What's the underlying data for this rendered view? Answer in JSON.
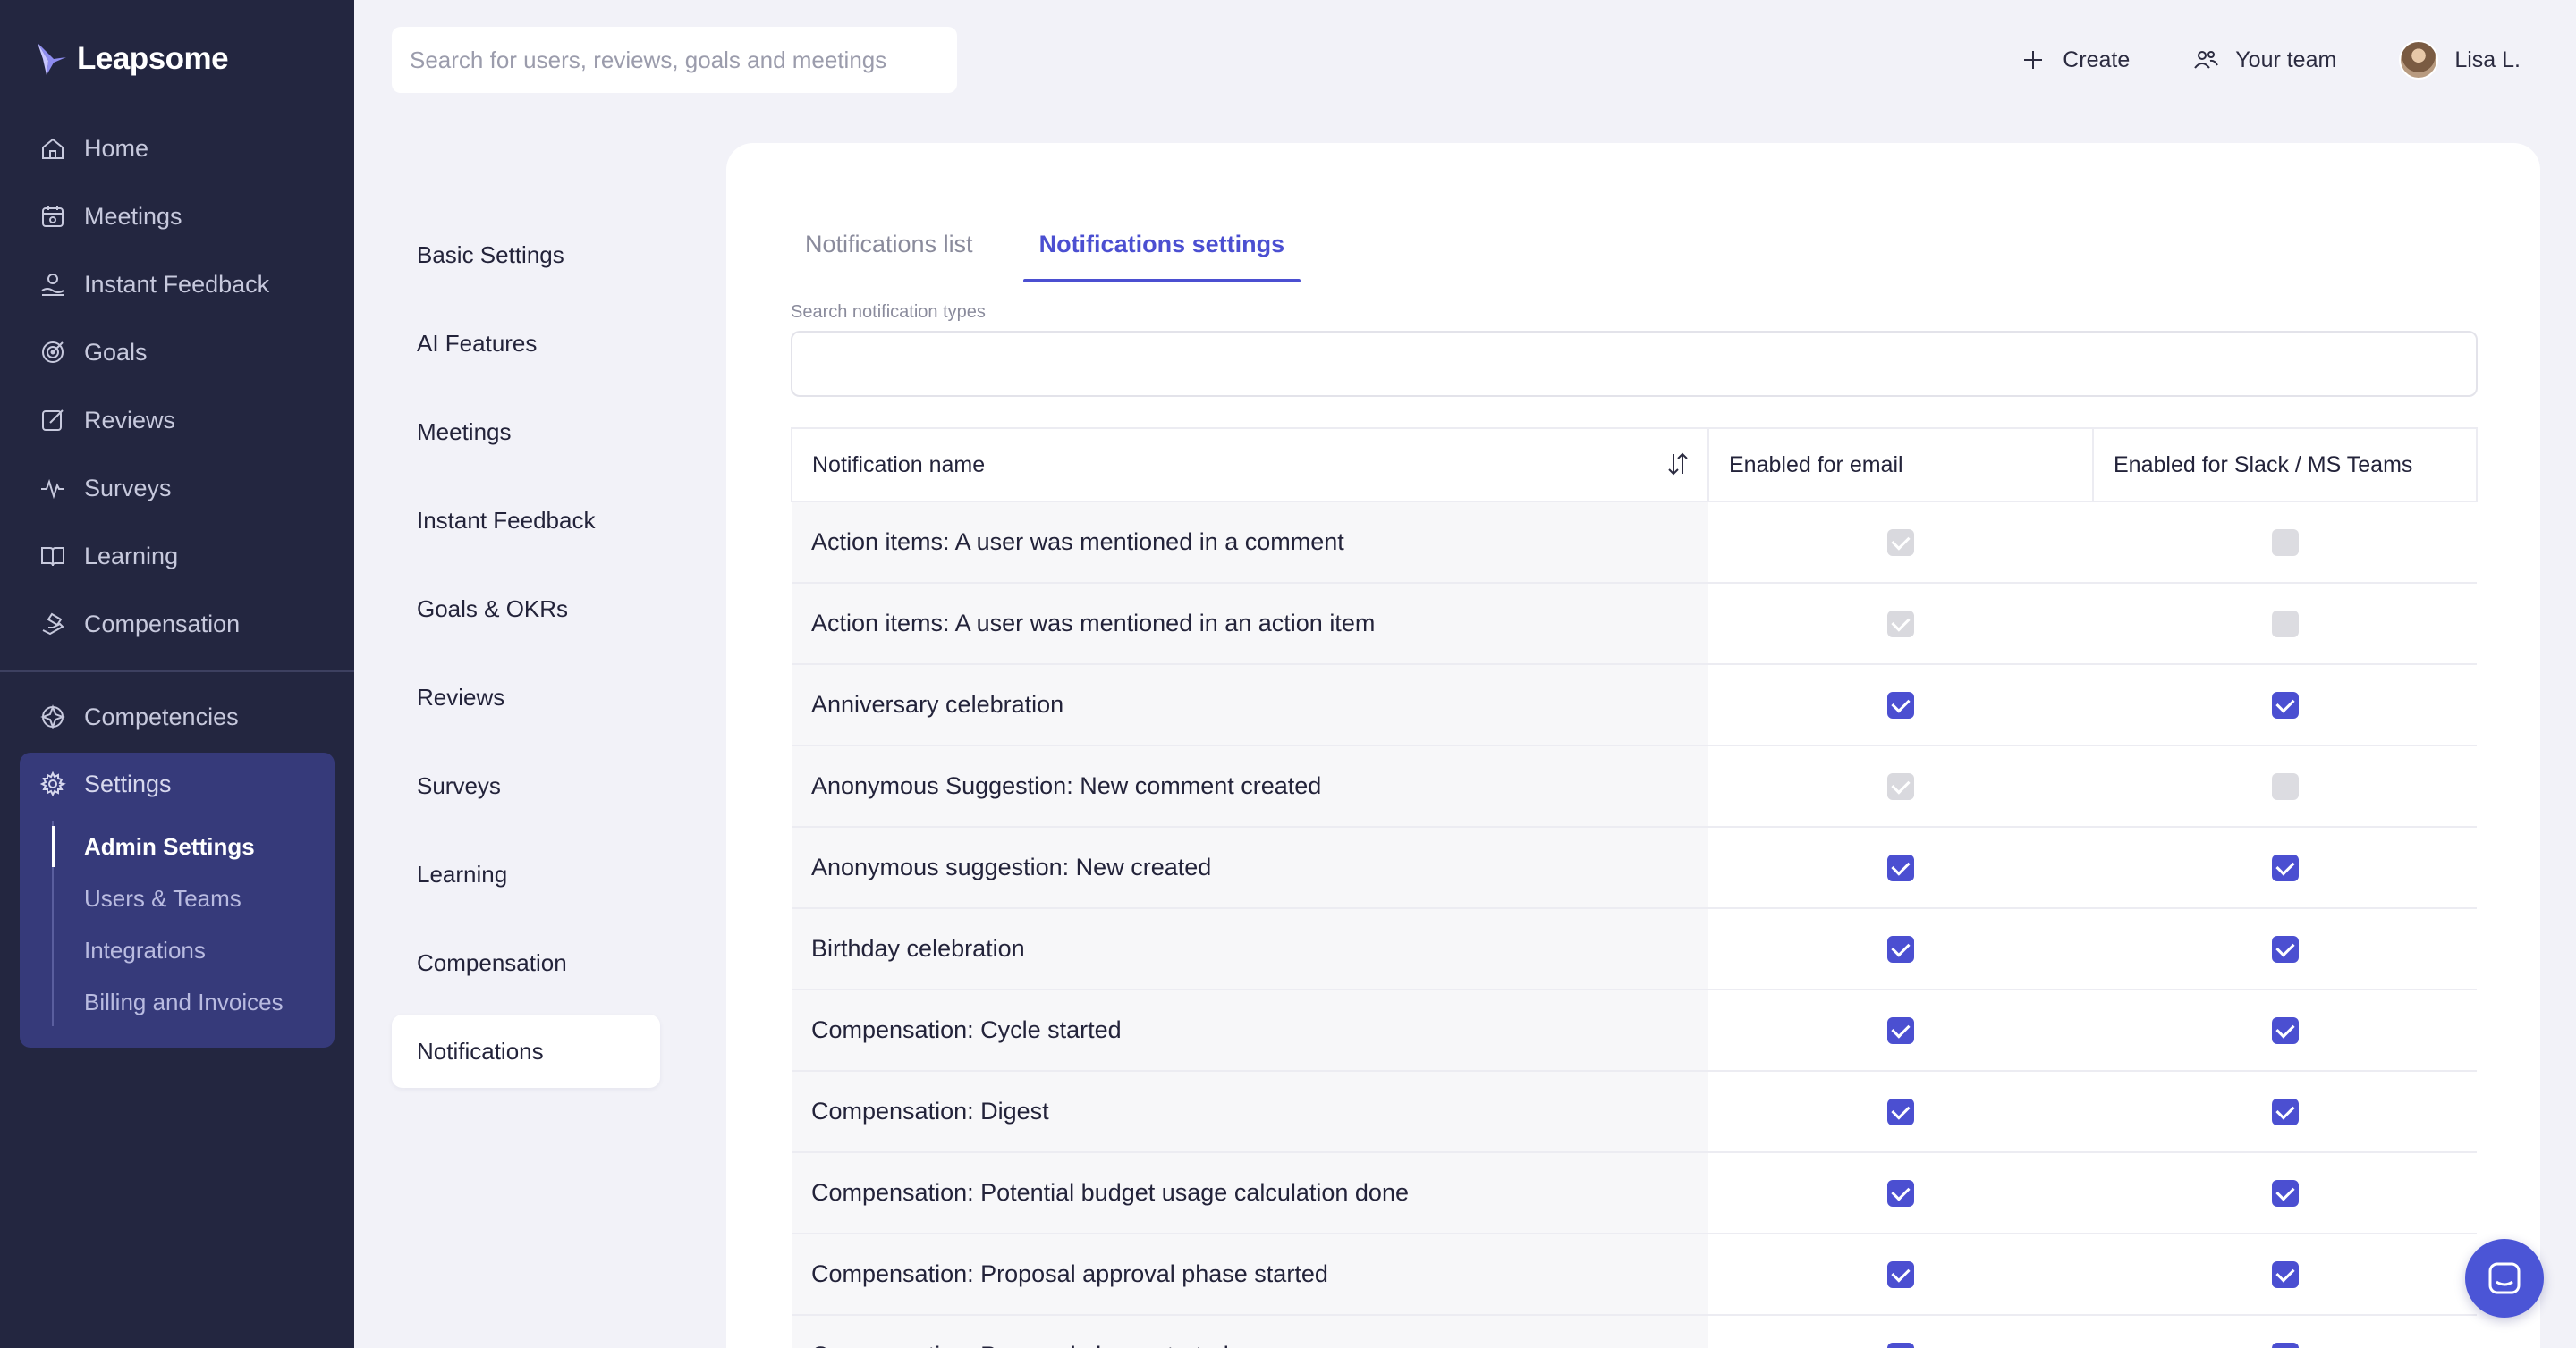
{
  "app": {
    "brand": "Leapsome"
  },
  "sidebar": {
    "items": [
      {
        "label": "Home",
        "icon": "home-icon"
      },
      {
        "label": "Meetings",
        "icon": "meetings-icon"
      },
      {
        "label": "Instant Feedback",
        "icon": "feedback-icon"
      },
      {
        "label": "Goals",
        "icon": "goals-icon"
      },
      {
        "label": "Reviews",
        "icon": "reviews-icon"
      },
      {
        "label": "Surveys",
        "icon": "surveys-icon"
      },
      {
        "label": "Learning",
        "icon": "learning-icon"
      },
      {
        "label": "Compensation",
        "icon": "compensation-icon"
      }
    ],
    "competencies": "Competencies",
    "settings": {
      "label": "Settings",
      "sub_items": [
        "Admin Settings",
        "Users & Teams",
        "Integrations",
        "Billing and Invoices"
      ],
      "active": "Admin Settings"
    }
  },
  "header": {
    "search_placeholder": "Search for users, reviews, goals and meetings",
    "create_label": "Create",
    "team_label": "Your team",
    "user_name": "Lisa L."
  },
  "settings_menu": {
    "items": [
      "Basic Settings",
      "AI Features",
      "Meetings",
      "Instant Feedback",
      "Goals & OKRs",
      "Reviews",
      "Surveys",
      "Learning",
      "Compensation",
      "Notifications"
    ],
    "active": "Notifications"
  },
  "main": {
    "tabs": [
      {
        "label": "Notifications list",
        "active": false
      },
      {
        "label": "Notifications settings",
        "active": true
      }
    ],
    "search_label": "Search notification types",
    "search_value": "",
    "columns": [
      "Notification name",
      "Enabled for email",
      "Enabled for Slack / MS Teams"
    ],
    "rows": [
      {
        "name": "Action items: A user was mentioned in a comment",
        "email": "disabled-checked",
        "slack": "disabled-unchecked"
      },
      {
        "name": "Action items: A user was mentioned in an action item",
        "email": "disabled-checked",
        "slack": "disabled-unchecked"
      },
      {
        "name": "Anniversary celebration",
        "email": "checked",
        "slack": "checked"
      },
      {
        "name": "Anonymous Suggestion: New comment created",
        "email": "disabled-checked",
        "slack": "disabled-unchecked"
      },
      {
        "name": "Anonymous suggestion: New created",
        "email": "checked",
        "slack": "checked"
      },
      {
        "name": "Birthday celebration",
        "email": "checked",
        "slack": "checked"
      },
      {
        "name": "Compensation: Cycle started",
        "email": "checked",
        "slack": "checked"
      },
      {
        "name": "Compensation: Digest",
        "email": "checked",
        "slack": "checked"
      },
      {
        "name": "Compensation: Potential budget usage calculation done",
        "email": "checked",
        "slack": "checked"
      },
      {
        "name": "Compensation: Proposal approval phase started",
        "email": "checked",
        "slack": "checked"
      },
      {
        "name": "Compensation: Proposal phase started",
        "email": "checked",
        "slack": "checked"
      }
    ]
  },
  "colors": {
    "sidebar_bg": "#232640",
    "accent": "#4b4fd1",
    "settings_active_bg": "#363a7a"
  }
}
